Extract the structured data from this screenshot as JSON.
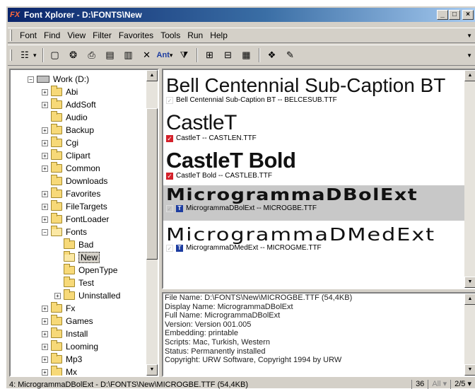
{
  "window": {
    "title": "Font Xplorer - D:\\FONTS\\New",
    "app_icon": "font-xplorer-logo",
    "controls": {
      "minimize": "_",
      "maximize": "□",
      "close": "×"
    }
  },
  "menu": [
    "Font",
    "Find",
    "View",
    "Filter",
    "Favorites",
    "Tools",
    "Run",
    "Help"
  ],
  "toolbar": {
    "font_dropdown_label": "Ant"
  },
  "tree": {
    "root": "Work (D:)",
    "items": [
      {
        "label": "Abi",
        "expander": "+"
      },
      {
        "label": "AddSoft",
        "expander": "+"
      },
      {
        "label": "Audio",
        "expander": ""
      },
      {
        "label": "Backup",
        "expander": "+"
      },
      {
        "label": "Cgi",
        "expander": "+"
      },
      {
        "label": "Clipart",
        "expander": "+"
      },
      {
        "label": "Common",
        "expander": "+"
      },
      {
        "label": "Downloads",
        "expander": ""
      },
      {
        "label": "Favorites",
        "expander": "+"
      },
      {
        "label": "FileTargets",
        "expander": "+"
      },
      {
        "label": "FontLoader",
        "expander": "+"
      },
      {
        "label": "Fonts",
        "expander": "−"
      }
    ],
    "fonts_children": [
      {
        "label": "Bad",
        "expander": ""
      },
      {
        "label": "New",
        "expander": ""
      },
      {
        "label": "OpenType",
        "expander": ""
      },
      {
        "label": "Test",
        "expander": ""
      },
      {
        "label": "Uninstalled",
        "expander": "+"
      }
    ],
    "more_items": [
      {
        "label": "Fx",
        "expander": "+"
      },
      {
        "label": "Games",
        "expander": "+"
      },
      {
        "label": "Install",
        "expander": "+"
      },
      {
        "label": "Looming",
        "expander": "+"
      },
      {
        "label": "Mp3",
        "expander": "+"
      },
      {
        "label": "Mx",
        "expander": "+"
      }
    ]
  },
  "fonts": [
    {
      "sample": "Bell Centennial Sub-Caption BT",
      "info": "Bell Centennial Sub-Caption BT -- BELCESUB.TTF",
      "marker": "grey-check"
    },
    {
      "sample": "CastleT",
      "info": "CastleT -- CASTLEN.TTF",
      "marker": "red-check"
    },
    {
      "sample": "CastleT Bold",
      "info": "CastleT Bold -- CASTLEB.TTF",
      "marker": "red-check"
    },
    {
      "sample": "MicrogrammaDBolExt",
      "info": "MicrogrammaDBolExt -- MICROGBE.TTF",
      "marker": "truetype"
    },
    {
      "sample": "MicrogrammaDMedExt",
      "info": "MicrogrammaDMedExt -- MICROGME.TTF",
      "marker": "truetype"
    }
  ],
  "details": [
    "File Name: D:\\FONTS\\New\\MICROGBE.TTF (54,4KB)",
    "Display Name: MicrogrammaDBolExt",
    "Full Name: MicrogrammaDBolExt",
    "Version: Version 001.005",
    "Embedding: printable",
    "Scripts: Mac, Turkish, Western",
    "Status: Permanently installed",
    "Copyright: URW Software, Copyright 1994 by URW"
  ],
  "status": {
    "main": "4: MicrogrammaDBolExt - D:\\FONTS\\New\\MICROGBE.TTF (54,4KB)",
    "count": "36",
    "filter": "All",
    "page": "2/5"
  },
  "colors": {
    "title_start": "#0a246a",
    "title_end": "#a6caf0",
    "highlight_row": "#c8c8c8",
    "check_red": "#d4212a",
    "truetype_blue": "#1c3ca0"
  }
}
